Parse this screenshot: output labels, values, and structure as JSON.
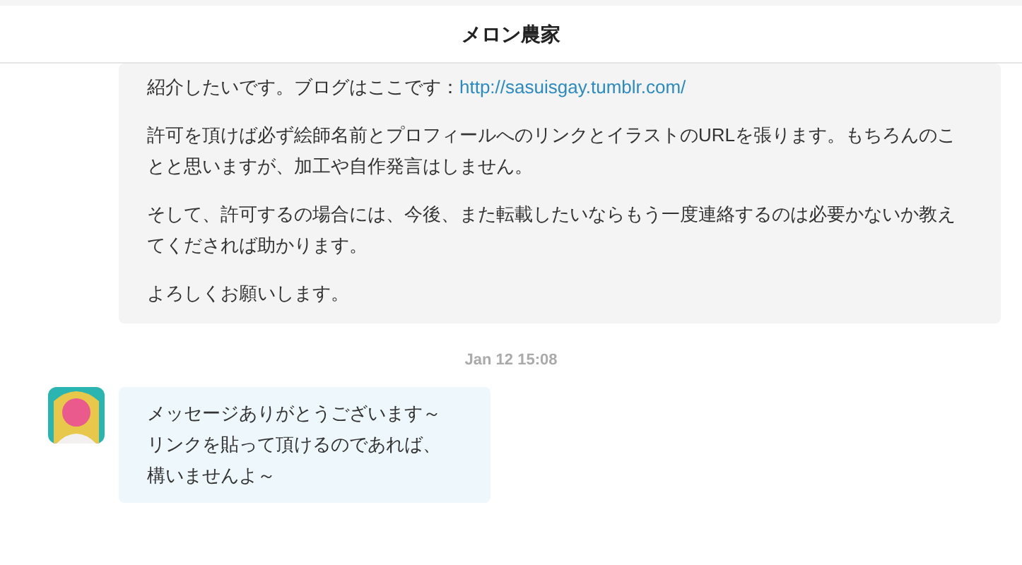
{
  "header": {
    "title": "メロン農家"
  },
  "messages": [
    {
      "kind": "received",
      "paragraphs": [
        {
          "text": "紹介したいです。ブログはここです：",
          "link": "http://sasuisgay.tumblr.com/"
        },
        {
          "text": "許可を頂けば必ず絵師名前とプロフィールへのリンクとイラストのURLを張ります。もちろんのことと思いますが、加工や自作発言はしません。"
        },
        {
          "text": "そして、許可するの場合には、今後、また転載したいならもう一度連絡するのは必要かないか教えてくだされば助かります。"
        },
        {
          "text": "よろしくお願いします。"
        }
      ]
    },
    {
      "kind": "timestamp",
      "text": "Jan 12 15:08"
    },
    {
      "kind": "reply",
      "paragraphs": [
        {
          "text": "メッセージありがとうございます～"
        },
        {
          "text": "リンクを貼って頂けるのであれば、"
        },
        {
          "text": "構いませんよ～"
        }
      ]
    }
  ]
}
